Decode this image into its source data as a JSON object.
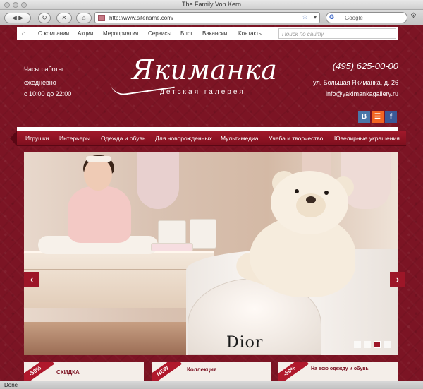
{
  "browser": {
    "window_title": "The Family Von Kern",
    "url": "http://www.sitename.com/",
    "search_placeholder": "Google",
    "status": "Done"
  },
  "topnav": {
    "items": [
      "О компании",
      "Акции",
      "Мероприятия",
      "Сервисы",
      "Блог",
      "Вакансии",
      "Контакты"
    ],
    "search_placeholder": "Поиск по сайту"
  },
  "header": {
    "hours_label": "Часы работы:",
    "hours_days": "ежедневно",
    "hours_time": "с 10:00 до 22:00",
    "logo_text": "Якиманка",
    "logo_subtitle": "детская галерея",
    "phone": "(495) 625-00-00",
    "address": "ул. Большая Якиманка, д. 26",
    "email": "info@yakimankagallery.ru",
    "social": [
      {
        "name": "vkontakte",
        "label": "В",
        "color": "#4a76a8"
      },
      {
        "name": "rss",
        "label": "☰",
        "color": "#f26522"
      },
      {
        "name": "facebook",
        "label": "f",
        "color": "#3b5998"
      }
    ]
  },
  "catnav": {
    "items": [
      "Игрушки",
      "Интерьеры",
      "Одежда и обувь",
      "Для новорожденных",
      "Мультимедиа",
      "Учеба и творчество",
      "Ювелирные украшения"
    ]
  },
  "slider": {
    "prev_label": "‹",
    "next_label": "›",
    "brand_text": "Dior",
    "slide_count": 4,
    "active_slide": 3
  },
  "promos": [
    {
      "ribbon": "-50%",
      "text": "СКИДКА"
    },
    {
      "ribbon": "NEW",
      "text": "Коллекция"
    },
    {
      "ribbon": "-50%",
      "text": "На всю одежду и обувь"
    }
  ],
  "colors": {
    "brand": "#7c1424",
    "accent": "#9d1628"
  }
}
